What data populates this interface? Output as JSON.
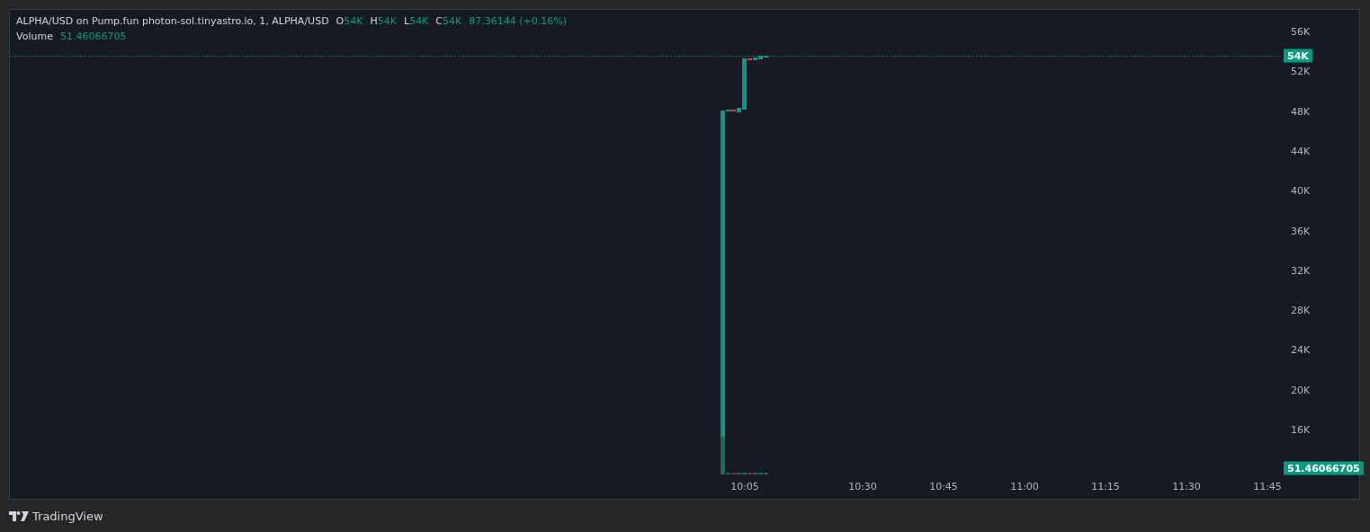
{
  "legend": {
    "title": "ALPHA/USD on Pump.fun photon-sol.tinyastro.io, 1, ALPHA/USD",
    "ohlc": [
      {
        "label": "O",
        "value": "54K"
      },
      {
        "label": "H",
        "value": "54K"
      },
      {
        "label": "L",
        "value": "54K"
      },
      {
        "label": "C",
        "value": "54K"
      }
    ],
    "change": "87.36144 (+0.16%)"
  },
  "volume": {
    "label": "Volume",
    "value": "51.46066705"
  },
  "price_axis": {
    "ticks": [
      "56K",
      "52K",
      "48K",
      "44K",
      "40K",
      "36K",
      "32K",
      "28K",
      "24K",
      "20K",
      "16K"
    ],
    "last_price": "54K",
    "last_volume": "51.46066705"
  },
  "time_axis": {
    "ticks": [
      "10:05",
      "10:30",
      "10:45",
      "11:00",
      "11:15",
      "11:30",
      "11:45"
    ]
  },
  "footer": {
    "brand": "TradingView"
  }
}
